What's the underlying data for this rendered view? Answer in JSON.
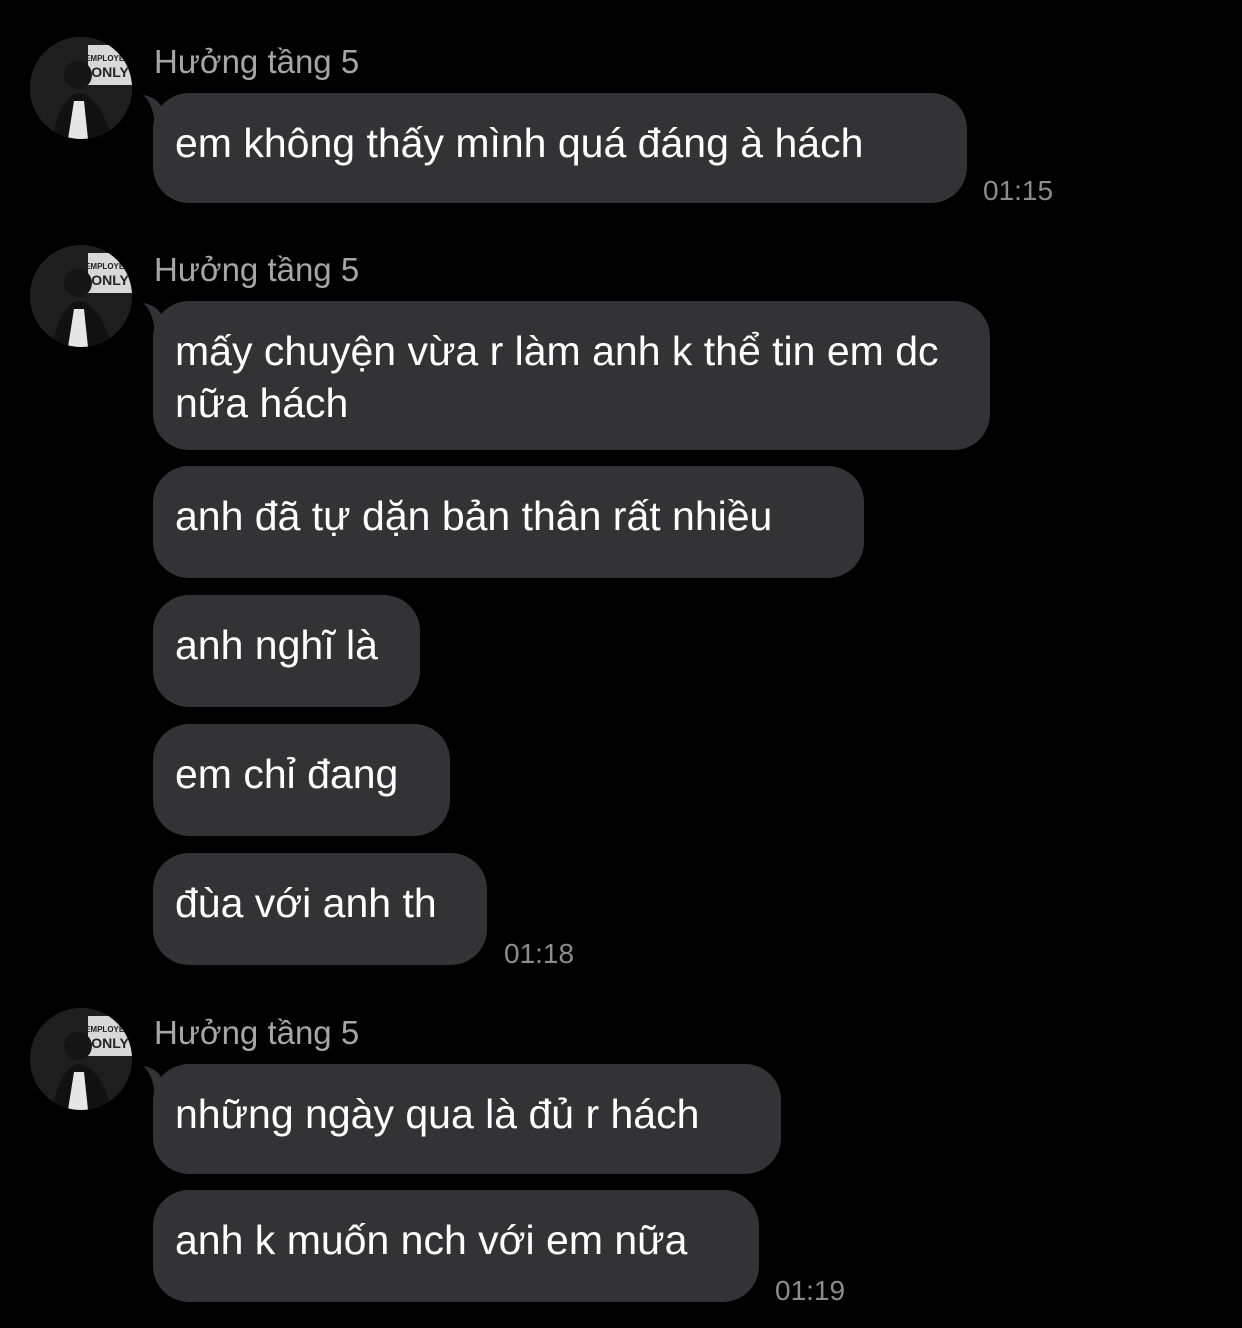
{
  "colors": {
    "background": "#000000",
    "bubble": "#333336",
    "sender_name": "#a6a6a6",
    "timestamp": "#8c8c8c",
    "message_text": "#ffffff"
  },
  "avatar": {
    "icon": "contact-avatar-photo",
    "sign_text": "EMPLOYEES ONLY"
  },
  "groups": [
    {
      "sender": "Hưởng tầng 5",
      "messages": [
        "em không thấy mình quá đáng à hách"
      ],
      "time": "01:15"
    },
    {
      "sender": "Hưởng tầng 5",
      "messages": [
        "mấy chuyện vừa r làm anh k thể tin em dc nữa hách",
        "anh đã tự dặn bản thân rất nhiều",
        "anh nghĩ là",
        "em chỉ đang",
        "đùa với anh th"
      ],
      "time": "01:18"
    },
    {
      "sender": "Hưởng tầng 5",
      "messages": [
        "những ngày qua là đủ r hách",
        "anh k muốn nch với em nữa"
      ],
      "time": "01:19"
    }
  ]
}
